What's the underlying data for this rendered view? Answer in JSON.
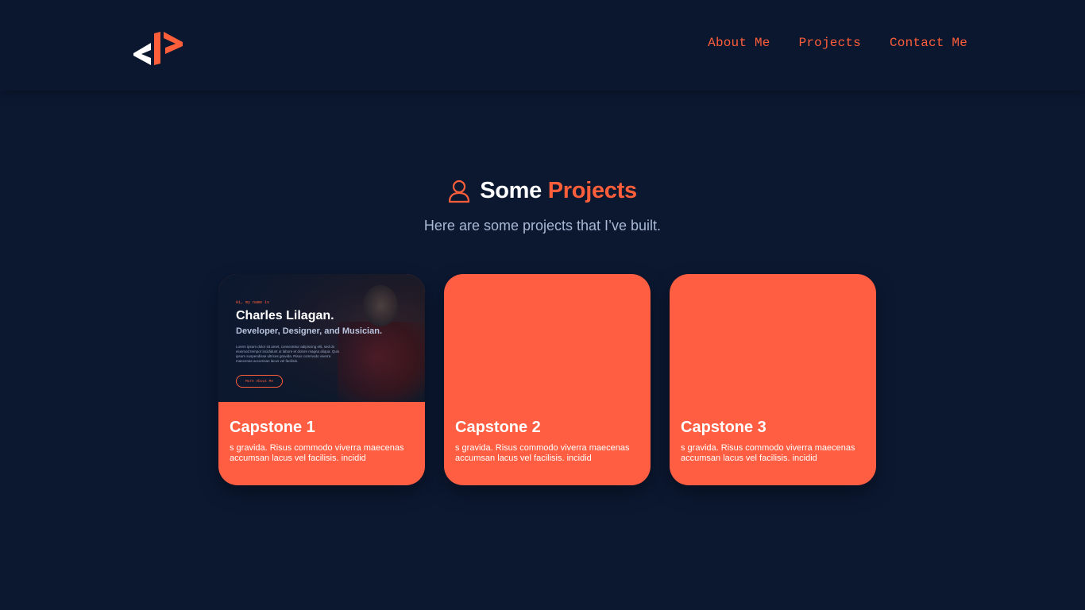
{
  "header": {
    "logo_icon": "code-brackets-logo-icon",
    "nav": [
      {
        "label": "About Me"
      },
      {
        "label": "Projects"
      },
      {
        "label": "Contact Me"
      }
    ]
  },
  "section": {
    "icon": "user-icon",
    "title_part1": "Some",
    "title_part2": "Projects",
    "subtitle": "Here are some projects that I’ve built."
  },
  "cards": [
    {
      "title": "Capstone 1",
      "description": "s gravida. Risus commodo viverra maecenas accumsan lacus vel facilisis. incidid",
      "preview": {
        "greeting": "Hi, my name is",
        "name": "Charles Lilagan.",
        "role": "Developer, Designer, and Musician.",
        "body": "Lorem ipsum dolor sit amet, consectetur adipiscing elit, sed do eiusmod tempor incididunt ut labore et dolore magna aliqua. Quis ipsum suspendisse ultrices gravida. Risus commodo viverra maecenas accumsan lacus vel facilisis.",
        "button": "More About Me"
      }
    },
    {
      "title": "Capstone 2",
      "description": "s gravida. Risus commodo viverra maecenas accumsan lacus vel facilisis. incidid"
    },
    {
      "title": "Capstone 3",
      "description": "s gravida. Risus commodo viverra maecenas accumsan lacus vel facilisis. incidid"
    }
  ],
  "colors": {
    "background": "#0b1830",
    "accent": "#ff5e3a",
    "subtitle": "#a9b8d4"
  }
}
